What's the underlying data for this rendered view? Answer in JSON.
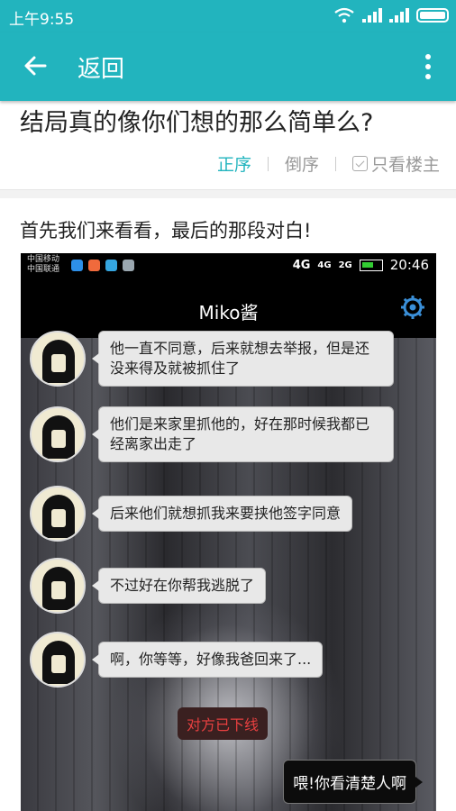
{
  "status_bar": {
    "time": "上午9:55"
  },
  "app_bar": {
    "back_label": "返回"
  },
  "post": {
    "title": "结局真的像你们想的那么简单么?"
  },
  "sort": {
    "asc": "正序",
    "desc": "倒序",
    "only_owner": "只看楼主"
  },
  "floor": {
    "text": "首先我们来看看，最后的那段对白!"
  },
  "embedded": {
    "carrier_1": "中国移动",
    "carrier_2": "中国联通",
    "net_4g": "4G",
    "net_4g_small": "4G",
    "net_2g": "2G",
    "time": "20:46",
    "chat_title": "Miko酱",
    "messages": [
      "他一直不同意，后来就想去举报，但是还没来得及就被抓住了",
      "他们是来家里抓他的，好在那时候我都已经离家出走了",
      "后来他们就想抓我来要挟他签字同意",
      "不过好在你帮我逃脱了",
      "啊，你等等，好像我爸回来了..."
    ],
    "offline_notice": "对方已下线",
    "reply": "喂!你看清楚人啊"
  }
}
